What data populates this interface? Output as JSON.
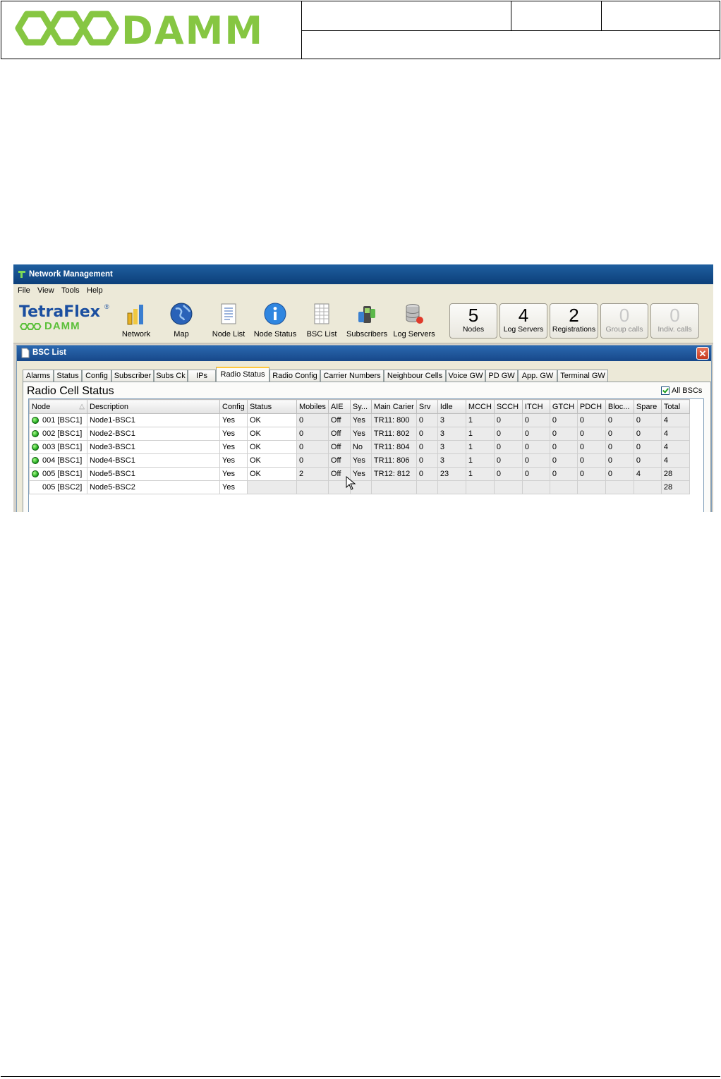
{
  "document_header": {
    "logo_text": "DAMM",
    "colors": {
      "logo_green": "#86c642"
    }
  },
  "app": {
    "title": "Network Management",
    "menu": [
      "File",
      "View",
      "Tools",
      "Help"
    ],
    "brand": {
      "name": "TetraFlex",
      "registered": "®",
      "sub": "DAMM"
    },
    "toolbar": [
      {
        "label": "Network",
        "icon": "network-bars-icon"
      },
      {
        "label": "Map",
        "icon": "globe-icon"
      },
      {
        "label": "Node List",
        "icon": "document-list-icon"
      },
      {
        "label": "Node Status",
        "icon": "info-icon"
      },
      {
        "label": "BSC List",
        "icon": "spreadsheet-icon"
      },
      {
        "label": "Subscribers",
        "icon": "handset-icon"
      },
      {
        "label": "Log Servers",
        "icon": "database-icon"
      }
    ],
    "counters": [
      {
        "value": "5",
        "label": "Nodes"
      },
      {
        "value": "4",
        "label": "Log Servers"
      },
      {
        "value": "2",
        "label": "Registrations"
      },
      {
        "value": "0",
        "label": "Group calls"
      },
      {
        "value": "0",
        "label": "Indiv. calls"
      }
    ],
    "bsc_window": {
      "title": "BSC List",
      "close": "✕",
      "tabs": [
        "Alarms",
        "Status",
        "Config",
        "Subscriber",
        "Subs Ck",
        "IPs",
        "Radio Status",
        "Radio Config",
        "Carrier Numbers",
        "Neighbour Cells",
        "Voice GW",
        "PD GW",
        "App. GW",
        "Terminal GW"
      ],
      "active_tab": "Radio Status",
      "panel_title": "Radio Cell Status",
      "all_bscs_label": "All BSCs",
      "all_bscs_checked": true,
      "columns": [
        "Node",
        "Description",
        "Config",
        "Status",
        "Mobiles",
        "AIE",
        "Sy...",
        "Main Carier",
        "Srv",
        "Idle",
        "MCCH",
        "SCCH",
        "ITCH",
        "GTCH",
        "PDCH",
        "Bloc...",
        "Spare",
        "Total"
      ],
      "sort_indicator": "△",
      "rows": [
        {
          "online": true,
          "cells": [
            "001 [BSC1]",
            "Node1-BSC1",
            "Yes",
            "OK",
            "0",
            "Off",
            "Yes",
            "TR11: 800",
            "0",
            "3",
            "1",
            "0",
            "0",
            "0",
            "0",
            "0",
            "0",
            "4"
          ]
        },
        {
          "online": true,
          "cells": [
            "002 [BSC1]",
            "Node2-BSC1",
            "Yes",
            "OK",
            "0",
            "Off",
            "Yes",
            "TR11: 802",
            "0",
            "3",
            "1",
            "0",
            "0",
            "0",
            "0",
            "0",
            "0",
            "4"
          ]
        },
        {
          "online": true,
          "cells": [
            "003 [BSC1]",
            "Node3-BSC1",
            "Yes",
            "OK",
            "0",
            "Off",
            "No",
            "TR11: 804",
            "0",
            "3",
            "1",
            "0",
            "0",
            "0",
            "0",
            "0",
            "0",
            "4"
          ]
        },
        {
          "online": true,
          "cells": [
            "004 [BSC1]",
            "Node4-BSC1",
            "Yes",
            "OK",
            "0",
            "Off",
            "Yes",
            "TR11: 806",
            "0",
            "3",
            "1",
            "0",
            "0",
            "0",
            "0",
            "0",
            "0",
            "4"
          ]
        },
        {
          "online": true,
          "cells": [
            "005 [BSC1]",
            "Node5-BSC1",
            "Yes",
            "OK",
            "2",
            "Off",
            "Yes",
            "TR12: 812",
            "0",
            "23",
            "1",
            "0",
            "0",
            "0",
            "0",
            "0",
            "4",
            "28"
          ]
        },
        {
          "online": false,
          "cells": [
            "005 [BSC2]",
            "Node5-BSC2",
            "Yes",
            "",
            "",
            "",
            "",
            "",
            "",
            "",
            "",
            "",
            "",
            "",
            "",
            "",
            "",
            "28"
          ]
        }
      ]
    }
  }
}
